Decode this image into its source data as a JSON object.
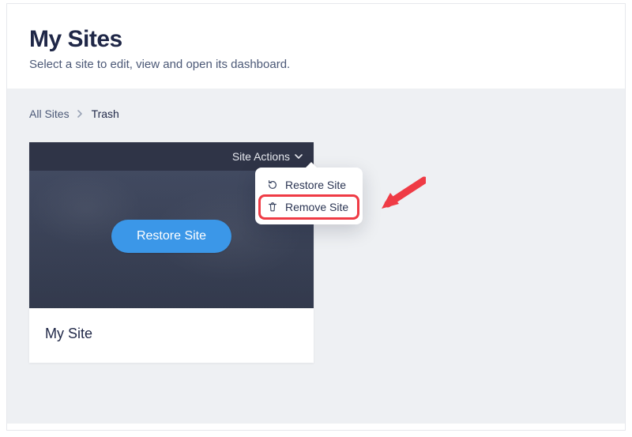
{
  "header": {
    "title": "My Sites",
    "subtitle": "Select a site to edit, view and open its dashboard."
  },
  "breadcrumb": {
    "root": "All Sites",
    "current": "Trash"
  },
  "card": {
    "actions_label": "Site Actions",
    "primary_button": "Restore Site",
    "site_name": "My Site"
  },
  "dropdown": {
    "restore": "Restore Site",
    "remove": "Remove Site"
  }
}
